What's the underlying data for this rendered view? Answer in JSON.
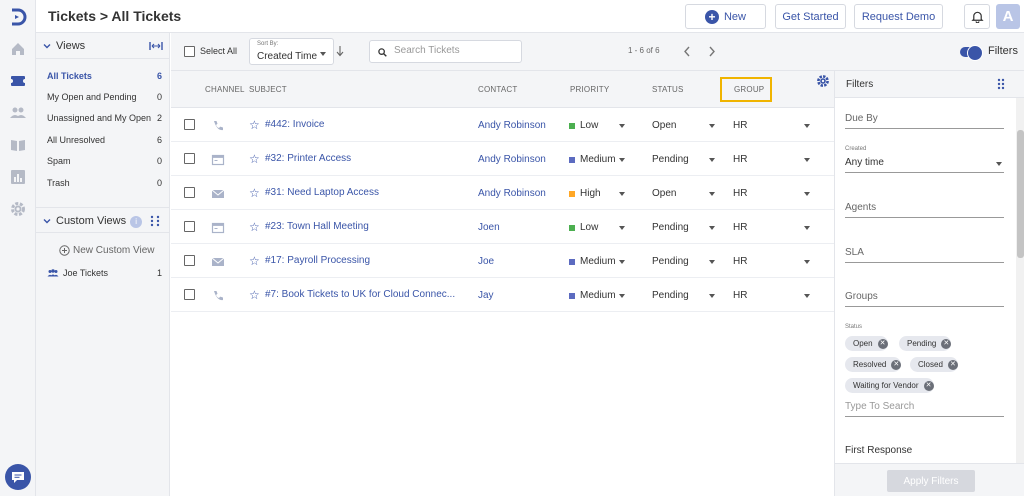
{
  "header": {
    "title": "Tickets > All Tickets",
    "new_label": "New",
    "get_started_label": "Get Started",
    "request_demo_label": "Request Demo",
    "avatar_initial": "A"
  },
  "views": {
    "title": "Views",
    "items": [
      {
        "label": "All Tickets",
        "count": "6"
      },
      {
        "label": "My Open and Pending",
        "count": "0"
      },
      {
        "label": "Unassigned and My Open",
        "count": "2"
      },
      {
        "label": "All Unresolved",
        "count": "6"
      },
      {
        "label": "Spam",
        "count": "0"
      },
      {
        "label": "Trash",
        "count": "0"
      }
    ],
    "custom_title": "Custom Views",
    "new_custom_label": "New Custom View",
    "custom_items": [
      {
        "label": "Joe Tickets",
        "count": "1"
      }
    ]
  },
  "toolbar": {
    "select_all_label": "Select All",
    "sort_caption": "Sort By:",
    "sort_value": "Created Time",
    "search_placeholder": "Search Tickets",
    "page_info": "1 - 6 of 6",
    "filters_label": "Filters"
  },
  "table": {
    "columns": {
      "channel": "CHANNEL",
      "subject": "SUBJECT",
      "contact": "CONTACT",
      "priority": "PRIORITY",
      "status": "STATUS",
      "group": "GROUP"
    },
    "rows": [
      {
        "channel": "phone",
        "subject": "#442: Invoice",
        "contact": "Andy Robinson",
        "priority": "Low",
        "priority_color": "#4caf50",
        "status": "Open",
        "group": "HR"
      },
      {
        "channel": "portal",
        "subject": "#32: Printer Access",
        "contact": "Andy Robinson",
        "priority": "Medium",
        "priority_color": "#5c6bc0",
        "status": "Pending",
        "group": "HR"
      },
      {
        "channel": "email",
        "subject": "#31: Need Laptop Access",
        "contact": "Andy Robinson",
        "priority": "High",
        "priority_color": "#ffa726",
        "status": "Open",
        "group": "HR"
      },
      {
        "channel": "portal",
        "subject": "#23: Town Hall Meeting",
        "contact": "Joen",
        "priority": "Low",
        "priority_color": "#4caf50",
        "status": "Pending",
        "group": "HR"
      },
      {
        "channel": "email",
        "subject": "#17: Payroll Processing",
        "contact": "Joe",
        "priority": "Medium",
        "priority_color": "#5c6bc0",
        "status": "Pending",
        "group": "HR"
      },
      {
        "channel": "phone",
        "subject": "#7: Book Tickets to UK for Cloud Connec...",
        "contact": "Jay",
        "priority": "Medium",
        "priority_color": "#5c6bc0",
        "status": "Pending",
        "group": "HR"
      }
    ]
  },
  "filters": {
    "title": "Filters",
    "due_by": "Due By",
    "created_caption": "Created",
    "created_value": "Any time",
    "agents": "Agents",
    "sla": "SLA",
    "groups": "Groups",
    "status_caption": "Status",
    "status_chips": [
      "Open",
      "Pending",
      "Resolved",
      "Closed",
      "Waiting for Vendor"
    ],
    "status_search_placeholder": "Type To Search",
    "first_response": "First Response",
    "apply_label": "Apply Filters"
  },
  "colors": {
    "accent": "#3a55a8",
    "highlight": "#f0b400"
  }
}
